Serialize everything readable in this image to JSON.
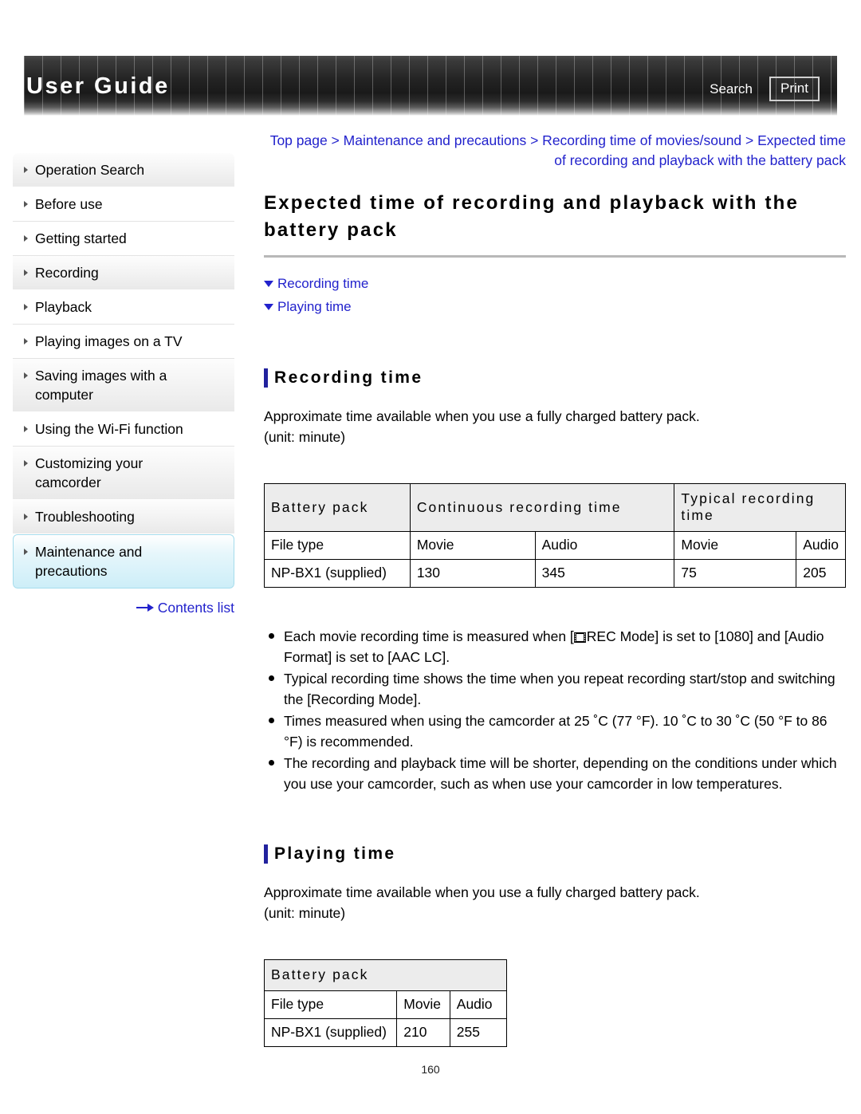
{
  "header": {
    "title": "User Guide",
    "search_label": "Search",
    "print_label": "Print"
  },
  "sidebar": {
    "items": [
      {
        "label": "Operation Search",
        "style": "shade",
        "active": false
      },
      {
        "label": "Before use",
        "style": "plain",
        "active": false
      },
      {
        "label": "Getting started",
        "style": "plain",
        "active": false
      },
      {
        "label": "Recording",
        "style": "shade",
        "active": false
      },
      {
        "label": "Playback",
        "style": "plain",
        "active": false
      },
      {
        "label": "Playing images on a TV",
        "style": "plain",
        "active": false
      },
      {
        "label": "Saving images with a computer",
        "style": "shade",
        "active": false
      },
      {
        "label": "Using the Wi-Fi function",
        "style": "plain",
        "active": false
      },
      {
        "label": "Customizing your camcorder",
        "style": "shade",
        "active": false
      },
      {
        "label": "Troubleshooting",
        "style": "shade",
        "active": false
      },
      {
        "label": "Maintenance and precautions",
        "style": "active",
        "active": true
      }
    ],
    "contents_link": "Contents list"
  },
  "main": {
    "breadcrumb": "Top page > Maintenance and precautions > Recording time of movies/sound > Expected time of recording and playback with the battery pack",
    "title": "Expected time of recording and playback with the battery pack",
    "anchors": [
      {
        "label": "Recording time"
      },
      {
        "label": "Playing time"
      }
    ],
    "sections": [
      {
        "heading": "Recording time",
        "intro_line1": "Approximate time available when you use a fully charged battery pack.",
        "intro_line2": "(unit: minute)"
      },
      {
        "heading": "Playing time",
        "intro_line1": "Approximate time available when you use a fully charged battery pack.",
        "intro_line2": "(unit: minute)"
      }
    ],
    "table_recording": {
      "header": [
        "Battery pack",
        "Continuous recording time",
        "Typical recording time"
      ],
      "subheader": [
        "File type",
        "Movie",
        "Audio",
        "Movie",
        "Audio"
      ],
      "row": [
        "NP-BX1 (supplied)",
        "130",
        "345",
        "75",
        "205"
      ]
    },
    "table_playing": {
      "header": "Battery pack",
      "subheader": [
        "File type",
        "Movie",
        "Audio"
      ],
      "row": [
        "NP-BX1 (supplied)",
        "210",
        "255"
      ]
    },
    "notes": [
      {
        "text_before": "Each movie recording time is measured when [",
        "has_icon": true,
        "icon": "film-strip-icon",
        "text_after": "REC Mode] is set to [1080] and [Audio Format] is set to [AAC LC]."
      },
      {
        "text_before": "Typical recording time shows the time when you repeat recording start/stop and switching the [Recording Mode].",
        "has_icon": false,
        "text_after": ""
      },
      {
        "text_before": "Times measured when using the camcorder at 25 ˚C (77 °F). 10 ˚C to 30 ˚C (50 °F to 86 °F) is recommended.",
        "has_icon": false,
        "text_after": ""
      },
      {
        "text_before": "The recording and playback time will be shorter, depending on the conditions under which you use your camcorder, such as when use your camcorder in low temperatures.",
        "has_icon": false,
        "text_after": ""
      }
    ],
    "page_number": "160"
  },
  "colors": {
    "link": "#2222cc",
    "accent_bar": "#22229e",
    "active_nav": "#cdeef8",
    "table_header_bg": "#ececec"
  }
}
